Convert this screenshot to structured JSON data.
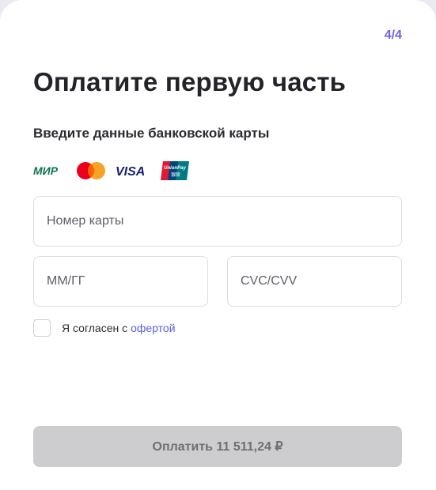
{
  "header": {
    "step": "4/4",
    "title": "Оплатите первую часть"
  },
  "card_section": {
    "subtitle": "Введите данные банковской карты",
    "logos": [
      {
        "icon": "mir-logo-icon",
        "text": "МИР",
        "color": "#0f754e"
      },
      {
        "icon": "mastercard-logo-icon",
        "colors": [
          "#eb001b",
          "#f79e1b"
        ]
      },
      {
        "icon": "visa-logo-icon",
        "text": "VISA",
        "color": "#1a1f71"
      },
      {
        "icon": "unionpay-logo-icon",
        "text": "UnionPay",
        "subtext": "银联",
        "colors": [
          "#e21836",
          "#00447c",
          "#007b84"
        ]
      }
    ],
    "card_number": {
      "placeholder": "Номер карты",
      "value": ""
    },
    "expiry": {
      "placeholder": "ММ/ГГ",
      "value": ""
    },
    "cvc": {
      "placeholder": "CVC/CVV",
      "value": ""
    }
  },
  "agreement": {
    "checked": false,
    "text": "Я согласен с",
    "link_text": "офертой"
  },
  "pay_button": {
    "label": "Оплатить 11 511,24 ₽"
  },
  "colors": {
    "accent": "#6b63e6",
    "link": "#5b5ee0",
    "button_disabled_bg": "#cdcdd0",
    "button_disabled_text": "#6e6e73",
    "border": "#dcdde3"
  }
}
